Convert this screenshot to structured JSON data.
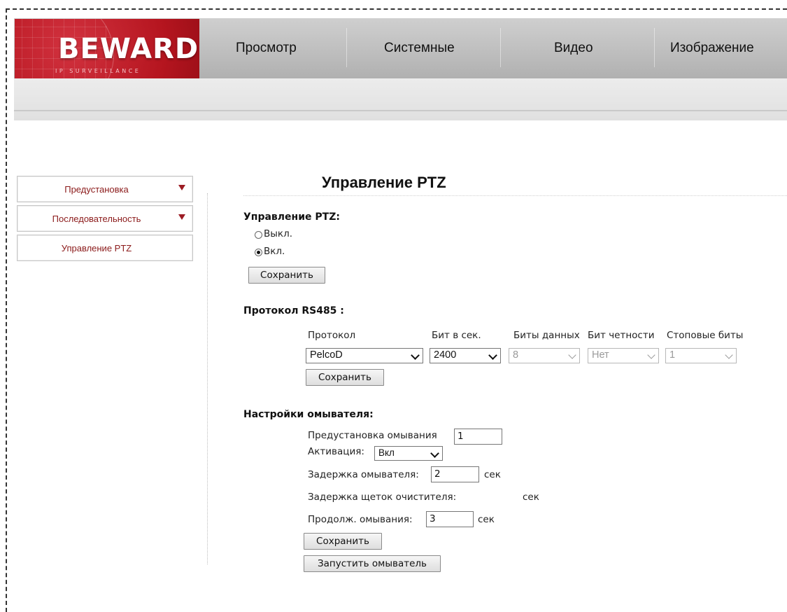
{
  "logo": {
    "brand": "BEWARD",
    "tagline": "IP SURVEILLANCE"
  },
  "nav": [
    "Просмотр",
    "Системные",
    "Видео",
    "Изображение"
  ],
  "sidebar": {
    "items": [
      {
        "label": "Предустановка",
        "has_arrow": true
      },
      {
        "label": "Последовательность",
        "has_arrow": true
      },
      {
        "label": "Управление PTZ",
        "has_arrow": false
      }
    ]
  },
  "page": {
    "title": "Управление PTZ"
  },
  "ptz": {
    "label": "Управление PTZ:",
    "off_label": "Выкл.",
    "on_label": "Вкл.",
    "selected": "on",
    "save": "Сохранить"
  },
  "rs485": {
    "label": "Протокол RS485 :",
    "headers": [
      "Протокол",
      "Бит в сек.",
      "Биты данных",
      "Бит четности",
      "Стоповые биты"
    ],
    "protocol": "PelcoD",
    "baud": "2400",
    "data_bits": "8",
    "parity": "Нет",
    "stop_bits": "1",
    "save": "Сохранить"
  },
  "washer": {
    "label": "Настройки омывателя:",
    "preset_label": "Предустановка омывания",
    "preset_value": "1",
    "activation_label": "Активация:",
    "activation_value": "Вкл",
    "delay_label": "Задержка омывателя:",
    "delay_value": "2",
    "brush_delay_label": "Задержка щеток очистителя:",
    "duration_label": "Продолж. омывания:",
    "duration_value": "3",
    "unit": "сек",
    "save": "Сохранить",
    "run": "Запустить омыватель"
  },
  "colors": {
    "brand_red": "#b5151f",
    "sidebar_text": "#8b1a1a"
  }
}
